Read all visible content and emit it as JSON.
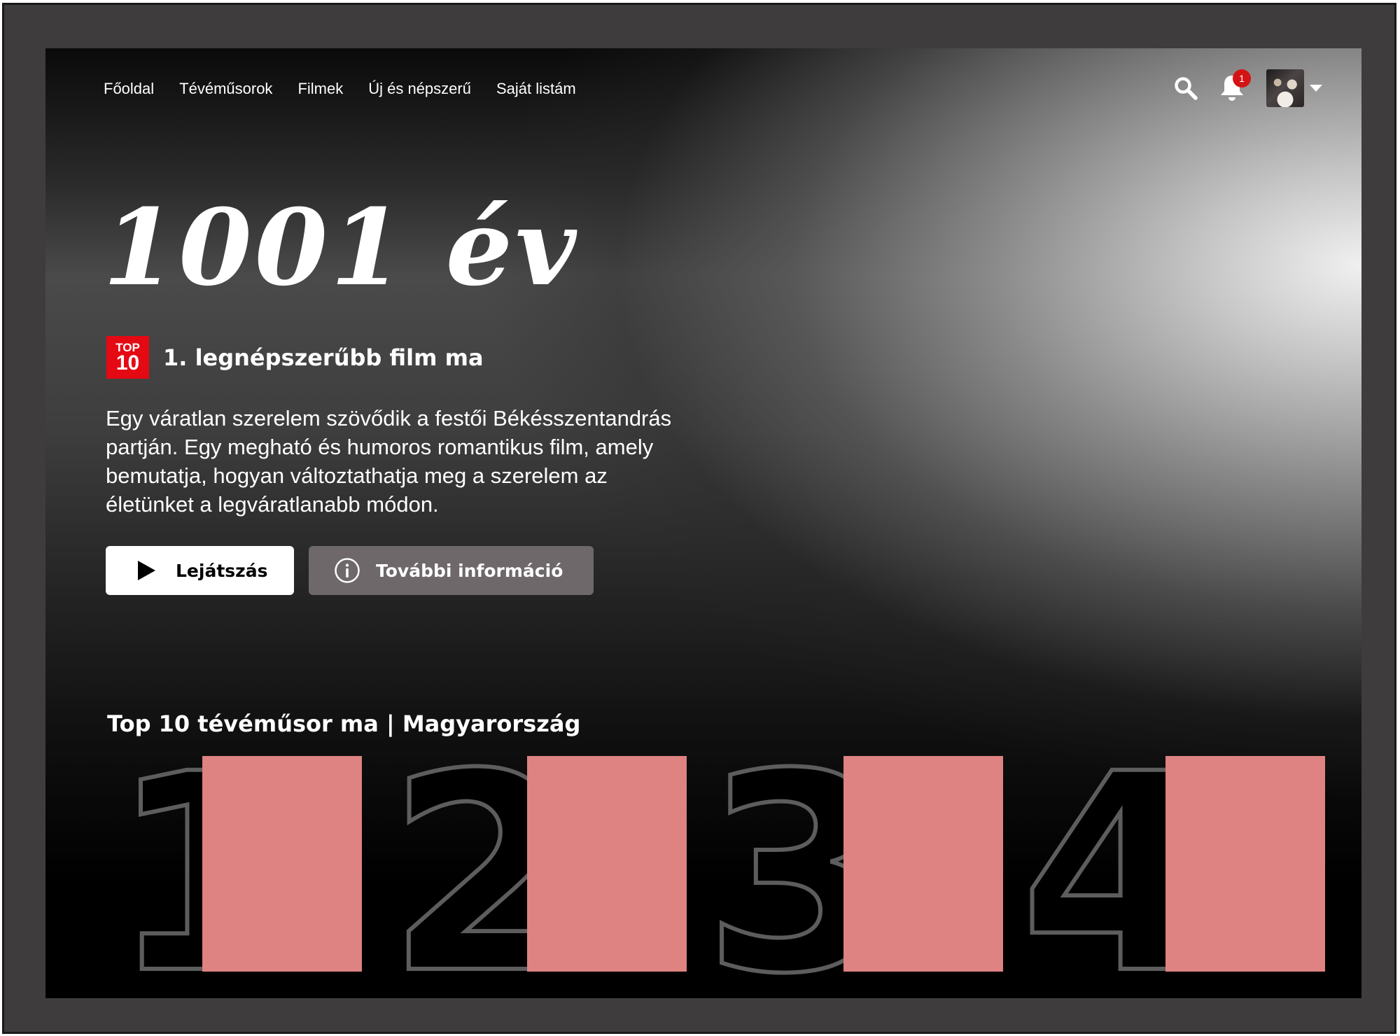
{
  "nav": {
    "items": [
      "Főoldal",
      "Tévéműsorok",
      "Filmek",
      "Új és népszerű",
      "Saját listám"
    ],
    "notification_count": "1"
  },
  "hero": {
    "title": "1001 év",
    "badge_top": "TOP",
    "badge_num": "10",
    "rank_text": "1. legnépszerűbb film ma",
    "description": "Egy váratlan szerelem szövődik a festői Békésszentandrás partján. Egy megható és humoros romantikus film, amely bemutatja, hogyan változtathatja meg a szerelem az életünket a legváratlanabb módon.",
    "play_label": "Lejátszás",
    "info_label": "További információ"
  },
  "top10": {
    "title": "Top 10 tévéműsor ma | Magyarország",
    "ranks": [
      "1",
      "2",
      "3",
      "4"
    ]
  },
  "colors": {
    "badge": "#e50914",
    "poster_placeholder": "#de8282",
    "info_button": "#6e686b"
  },
  "icons": [
    "search-icon",
    "bell-icon",
    "avatar",
    "caret-down-icon",
    "play-icon",
    "info-icon"
  ]
}
